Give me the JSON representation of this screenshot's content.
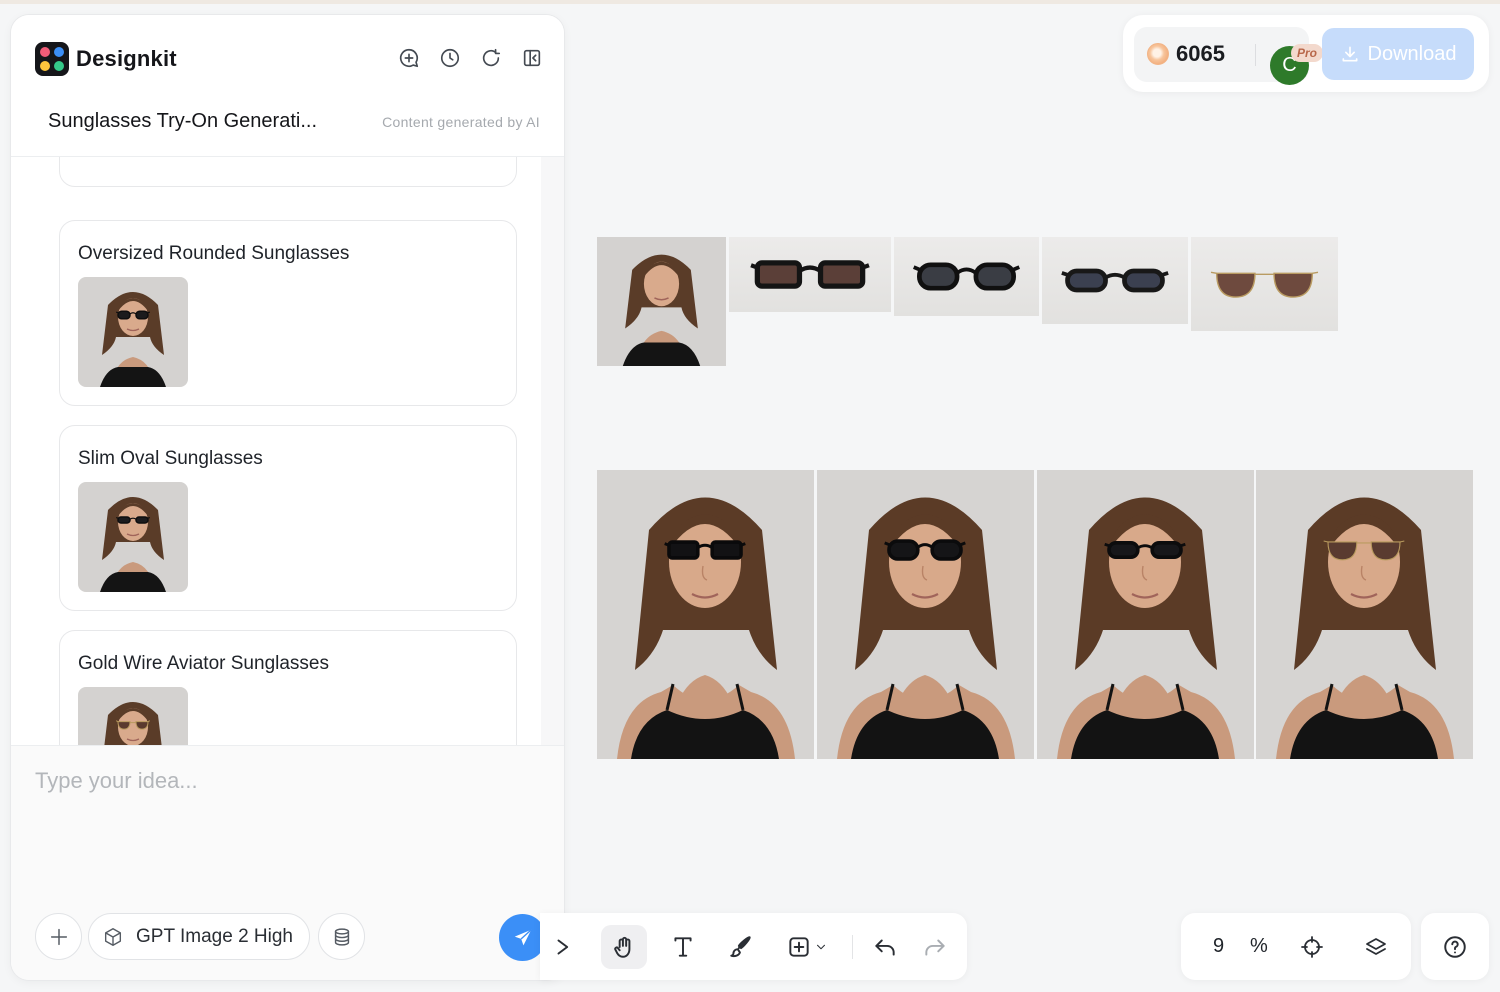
{
  "app": {
    "name": "Designkit",
    "logo_colors": [
      "#f25c78",
      "#3b8ff7",
      "#ffc53d",
      "#35c98a"
    ]
  },
  "header": {
    "icons": [
      "new-chat-icon",
      "history-icon",
      "refresh-icon",
      "collapse-panel-icon"
    ],
    "conversation_title": "Sunglasses Try-On Generati...",
    "ai_note": "Content generated by AI"
  },
  "results": [
    {
      "title": "Oversized Rounded Sunglasses",
      "lens": "#1b1b1d",
      "frame": "#0e0e0f",
      "style": "rounded"
    },
    {
      "title": "Slim Oval Sunglasses",
      "lens": "#1c1c1e",
      "frame": "#0e0e0f",
      "style": "oval"
    },
    {
      "title": "Gold Wire Aviator Sunglasses",
      "lens": "#5a3a2e",
      "frame": "#b89a5e",
      "style": "aviator"
    }
  ],
  "composer": {
    "placeholder": "Type your idea...",
    "model_label": "GPT Image 2 High",
    "icons": [
      "add-icon",
      "model-cube-icon",
      "stack-icon",
      "send-icon"
    ]
  },
  "account": {
    "credits": "6065",
    "avatar_initial": "C",
    "badge": "Pro",
    "download_label": "Download"
  },
  "canvas": {
    "reference_row": [
      {
        "kind": "portrait"
      },
      {
        "kind": "glasses",
        "lens": "#5b3f38",
        "frame": "#141414",
        "style": "rect"
      },
      {
        "kind": "glasses",
        "lens": "#3a3d44",
        "frame": "#101010",
        "style": "rounded"
      },
      {
        "kind": "glasses",
        "lens": "#3b4050",
        "frame": "#181818",
        "style": "oval"
      },
      {
        "kind": "glasses",
        "lens": "#6e4a3e",
        "frame": "#b99b62",
        "style": "aviator"
      }
    ],
    "result_row": [
      {
        "lens": "#121214",
        "frame": "#0a0a0b",
        "style": "rect"
      },
      {
        "lens": "#151517",
        "frame": "#0b0b0c",
        "style": "rounded"
      },
      {
        "lens": "#17171a",
        "frame": "#0c0c0d",
        "style": "oval"
      },
      {
        "lens": "#5a3b30",
        "frame": "#b89a5e",
        "style": "aviator"
      }
    ]
  },
  "toolbar": {
    "tools": [
      "select-arrow-icon",
      "hand-icon",
      "text-icon",
      "brush-icon",
      "insert-icon",
      "undo-icon",
      "redo-icon"
    ],
    "active": "hand-icon"
  },
  "zoom": {
    "value": "9",
    "unit": "%"
  },
  "colors": {
    "accent": "#3b8ff7",
    "download_bg": "#c6dcfb",
    "avatar": "#2e7a2a"
  }
}
